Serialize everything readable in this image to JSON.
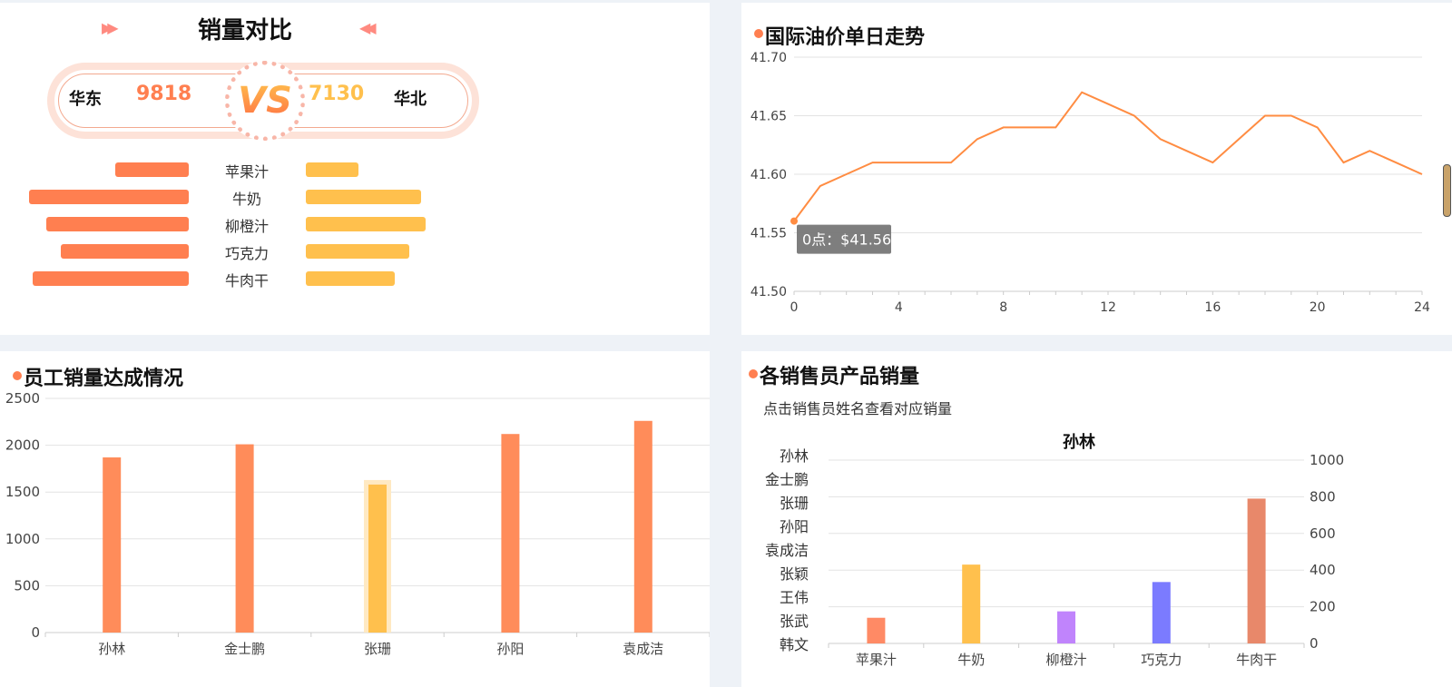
{
  "comparison": {
    "title": "销量对比",
    "left_region": "华东",
    "left_total": "9818",
    "right_region": "华北",
    "right_total": "7130",
    "vs": "VS",
    "products": [
      "苹果汁",
      "牛奶",
      "柳橙汁",
      "巧克力",
      "牛肉干"
    ],
    "left_values_fraction": [
      0.46,
      1.0,
      0.89,
      0.8,
      0.98
    ],
    "right_values_fraction": [
      0.44,
      0.96,
      1.0,
      0.86,
      0.74
    ],
    "colors": {
      "left": "#ff7f50",
      "right": "#ffc04d"
    }
  },
  "oil": {
    "title": "国际油价单日走势",
    "tooltip": "0点：$41.56"
  },
  "staff": {
    "title": "员工销量达成情况"
  },
  "reps": {
    "title": "各销售员产品销量",
    "hint": "点击销售员姓名查看对应销量",
    "names": [
      "孙林",
      "金士鹏",
      "张珊",
      "孙阳",
      "袁成洁",
      "张颖",
      "王伟",
      "张武",
      "韩文"
    ],
    "selected": "孙林"
  },
  "chart_data": [
    {
      "type": "line",
      "title": "国际油价单日走势",
      "x": [
        0,
        1,
        2,
        3,
        4,
        5,
        6,
        7,
        8,
        9,
        10,
        11,
        12,
        13,
        14,
        15,
        16,
        17,
        18,
        19,
        20,
        21,
        22,
        23,
        24
      ],
      "y": [
        41.56,
        41.59,
        41.6,
        41.61,
        41.61,
        41.61,
        41.61,
        41.63,
        41.64,
        41.64,
        41.64,
        41.67,
        41.66,
        41.65,
        41.63,
        41.62,
        41.61,
        41.63,
        41.65,
        41.65,
        41.64,
        41.61,
        41.62,
        41.61,
        41.6
      ],
      "xticks": [
        0,
        4,
        8,
        12,
        16,
        20,
        24
      ],
      "ylim": [
        41.5,
        41.7
      ],
      "yticks": [
        "41.50",
        "41.55",
        "41.60",
        "41.65",
        "41.70"
      ],
      "color": "#ff8c42",
      "grid": true
    },
    {
      "type": "bar",
      "title": "员工销量达成情况",
      "categories": [
        "孙林",
        "金士鹏",
        "张珊",
        "孙阳",
        "袁成洁"
      ],
      "values": [
        1870,
        2010,
        1580,
        2120,
        2260
      ],
      "highlight_index": 2,
      "ylim": [
        0,
        2500
      ],
      "yticks": [
        0,
        500,
        1000,
        1500,
        2000,
        2500
      ],
      "colors": {
        "bar": "#ff8c5a",
        "highlight": "#ffc04d"
      }
    },
    {
      "type": "bar",
      "title": "孙林",
      "categories": [
        "苹果汁",
        "牛奶",
        "柳橙汁",
        "巧克力",
        "牛肉干"
      ],
      "values": [
        140,
        430,
        175,
        335,
        790
      ],
      "ylim": [
        0,
        1000
      ],
      "yticks": [
        0,
        200,
        400,
        600,
        800,
        1000
      ],
      "y_axis_position": "right",
      "colors": [
        "#ff8a65",
        "#ffc04d",
        "#c084fc",
        "#7b7bff",
        "#e8886a"
      ]
    }
  ]
}
